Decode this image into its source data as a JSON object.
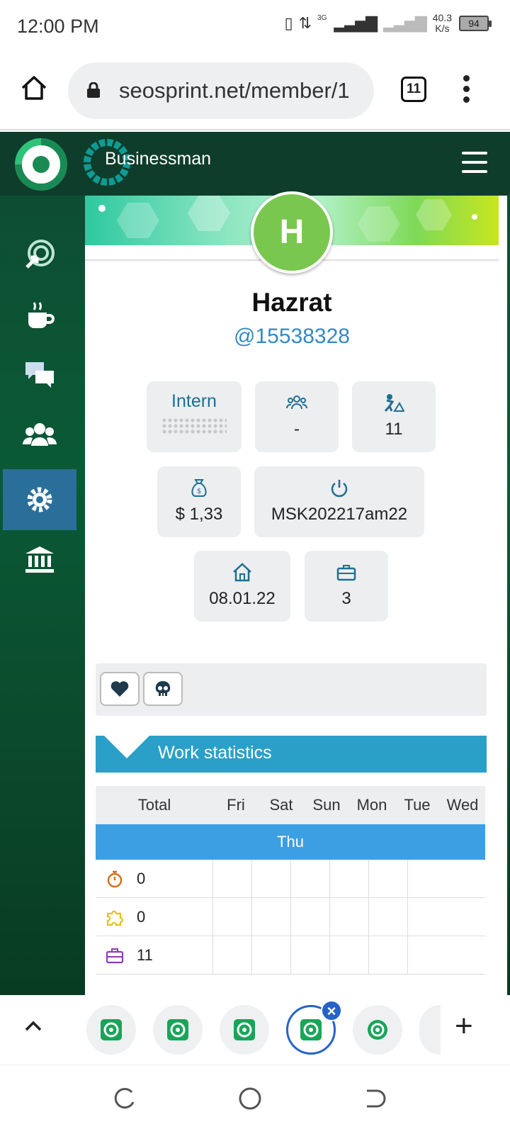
{
  "status": {
    "time": "12:00 PM",
    "net_type": "3G",
    "speed": "40.3",
    "speed_unit": "K/s",
    "battery": "94"
  },
  "browser": {
    "url": "seosprint.net/member/1",
    "tab_count": "11"
  },
  "site": {
    "brand": "Businessman",
    "sidebar": [
      {
        "icon": "target-click-icon"
      },
      {
        "icon": "coffee-cup-icon"
      },
      {
        "icon": "chat-icon"
      },
      {
        "icon": "users-icon"
      },
      {
        "icon": "settings-icon",
        "active": true
      },
      {
        "icon": "bank-icon"
      }
    ]
  },
  "profile": {
    "avatar_letter": "H",
    "name": "Hazrat",
    "handle": "@15538328",
    "rank": "Intern",
    "referrals": "-",
    "tasks_done": "11",
    "balance": "$ 1,33",
    "last_online": "MSK202217am22",
    "registered": "08.01.22",
    "tasks": "3"
  },
  "work_stats": {
    "title": "Work statistics",
    "columns": [
      "Total",
      "Fri",
      "Sat",
      "Sun",
      "Mon",
      "Tue",
      "Wed"
    ],
    "today": "Thu",
    "rows": [
      {
        "icon": "stopwatch-icon",
        "total": "0"
      },
      {
        "icon": "puzzle-icon",
        "total": "0"
      },
      {
        "icon": "briefcase-icon",
        "total": "11"
      }
    ]
  }
}
